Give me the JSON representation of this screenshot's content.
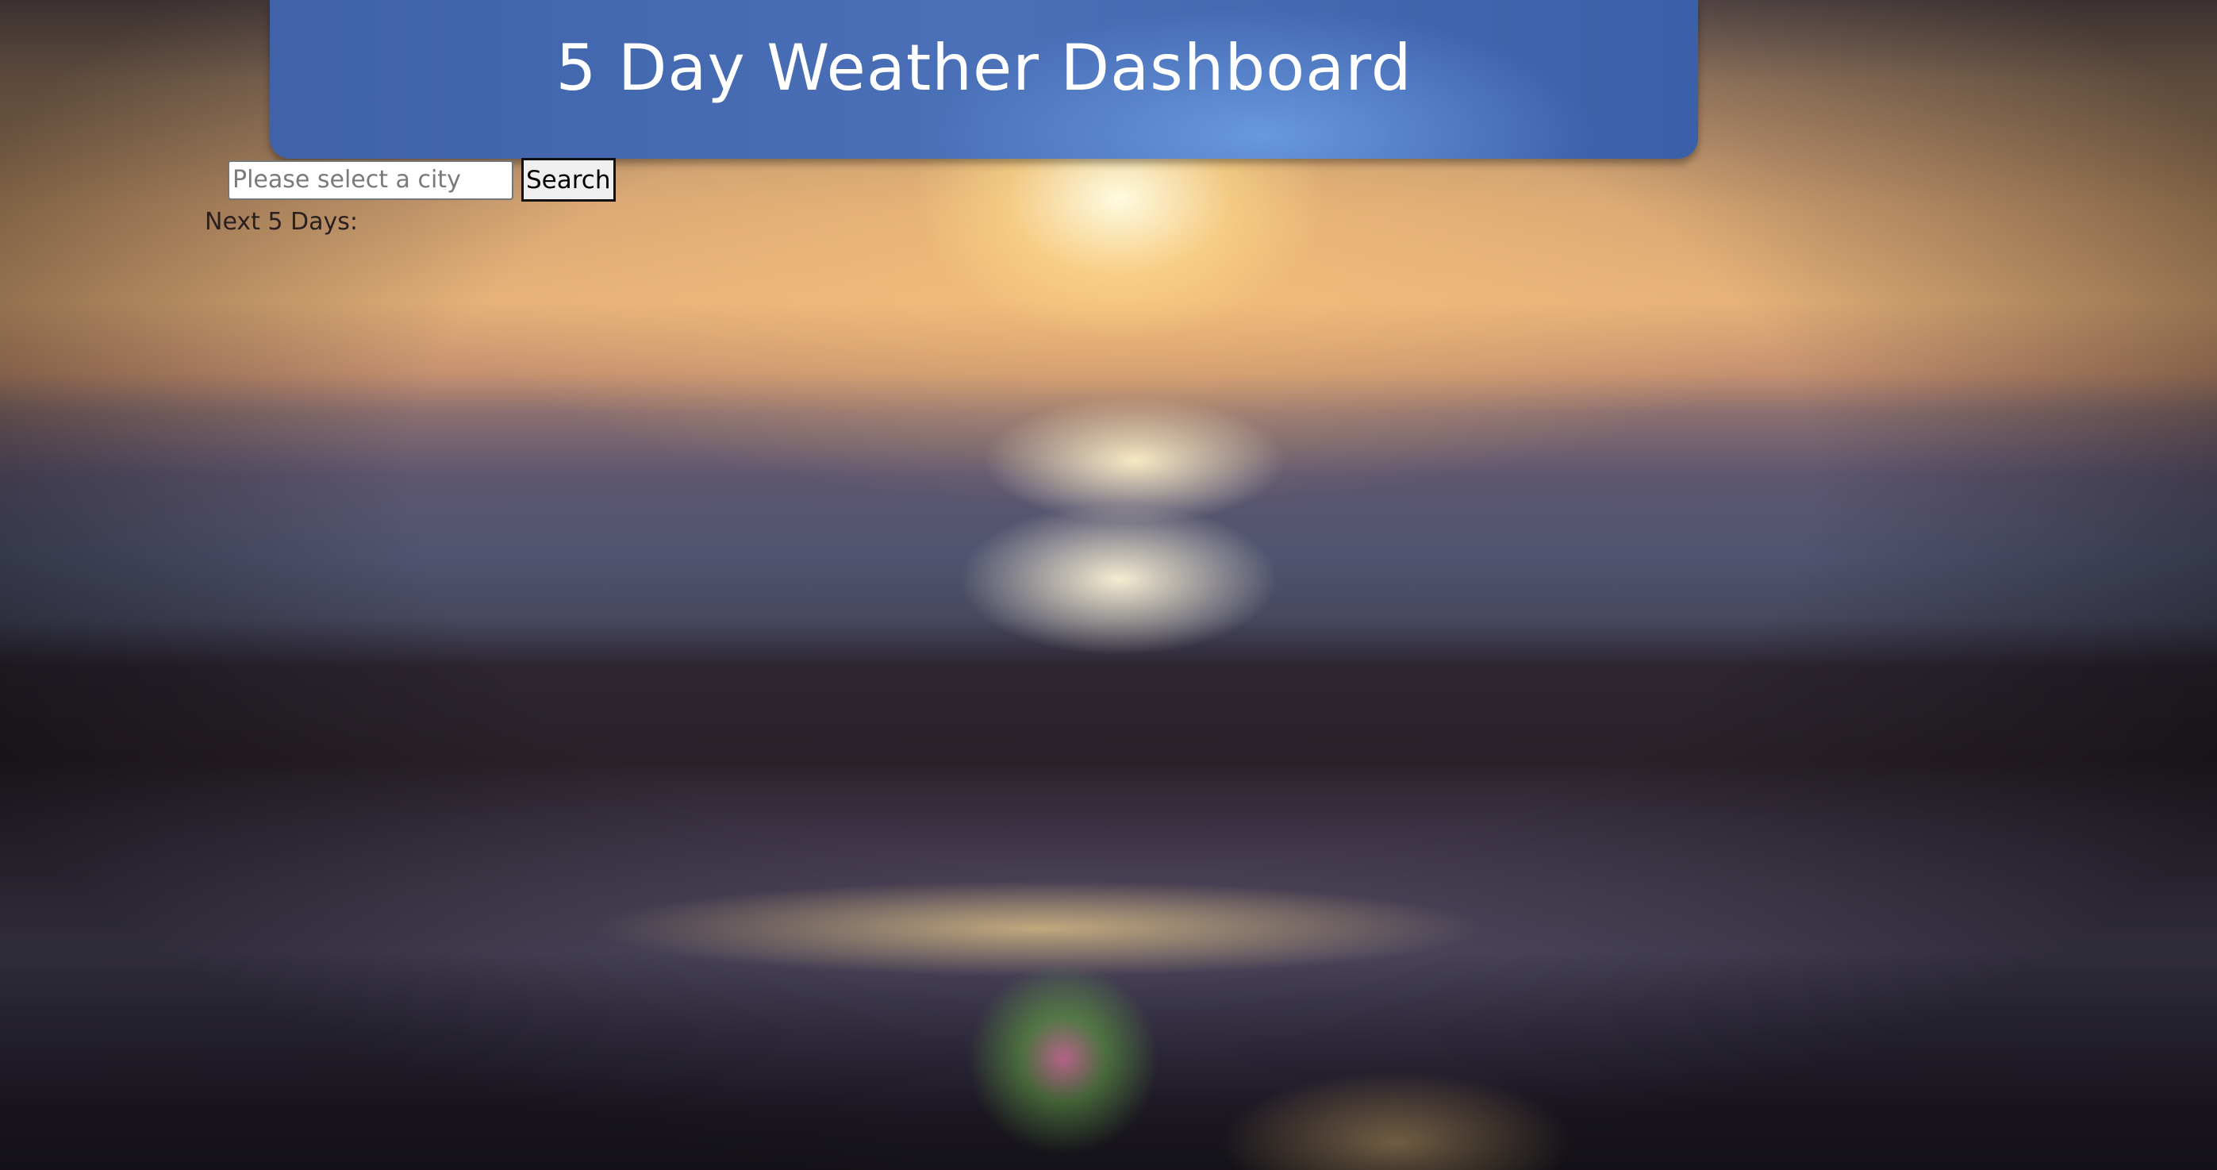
{
  "header": {
    "title": "5 Day Weather Dashboard"
  },
  "search": {
    "placeholder": "Please select a city",
    "value": "",
    "button_label": "Search"
  },
  "forecast": {
    "label": "Next 5 Days:"
  },
  "colors": {
    "header_background": "#4a70b8",
    "header_text": "#ffffff"
  }
}
